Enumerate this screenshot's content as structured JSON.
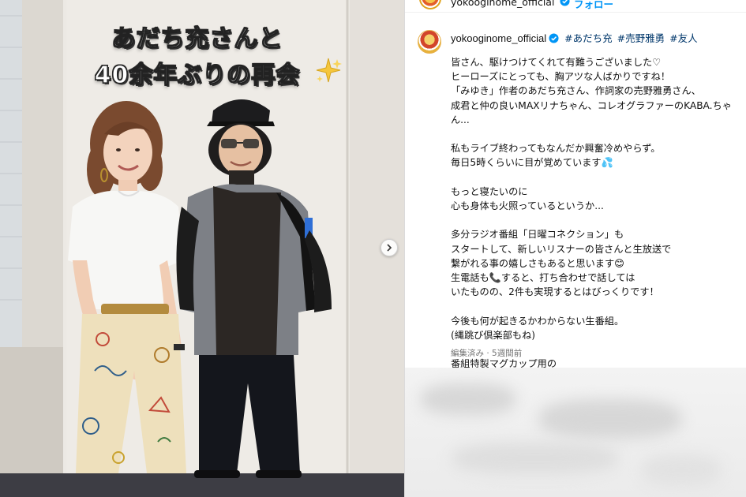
{
  "header": {
    "username": "yokooginome_official",
    "follow_label": "フォロー"
  },
  "photo": {
    "caption_line1": "あだち充さんと",
    "caption_line2": "40余年ぶりの再会",
    "sparkle_icon": "sparkles-icon",
    "next_icon": "chevron-right-icon"
  },
  "post": {
    "username": "yokooginome_official",
    "hashtags": [
      "#あだち充",
      "#売野雅勇",
      "#友人"
    ],
    "caption": "皆さん、駆けつけてくれて有難うございました♡\nヒーローズにとっても、胸アツな人ばかりですね！\n「みゆき」作者のあだち充さん、作詞家の売野雅勇さん、\n成君と仲の良いMAXリナちゃん、コレオグラファーのKABA.ちゃん...\n\n私もライブ終わってもなんだか興奮冷めやらず。\n毎日5時くらいに目が覚めています💦\n\nもっと寝たいのに\n心も身体も火照っているというか...\n\n多分ラジオ番組「日曜コネクション」も\nスタートして、新しいリスナーの皆さんと生放送で\n繋がれる事の嬉しさもあると思います😊\n生電話も📞すると、打ち合わせで話しては\nいたものの、2件も実現するとはびっくりです！\n\n今後も何が起きるかわからない生番組。\n(縄跳び倶楽部もね)\n\n番組特製マグカップ用の\nイラストも描かなくちゃ！✍️",
    "meta": "編集済み · 5週間前"
  },
  "colors": {
    "link": "#00376b",
    "follow": "#0095f6",
    "verified": "#0095f6",
    "meta": "#737373"
  }
}
